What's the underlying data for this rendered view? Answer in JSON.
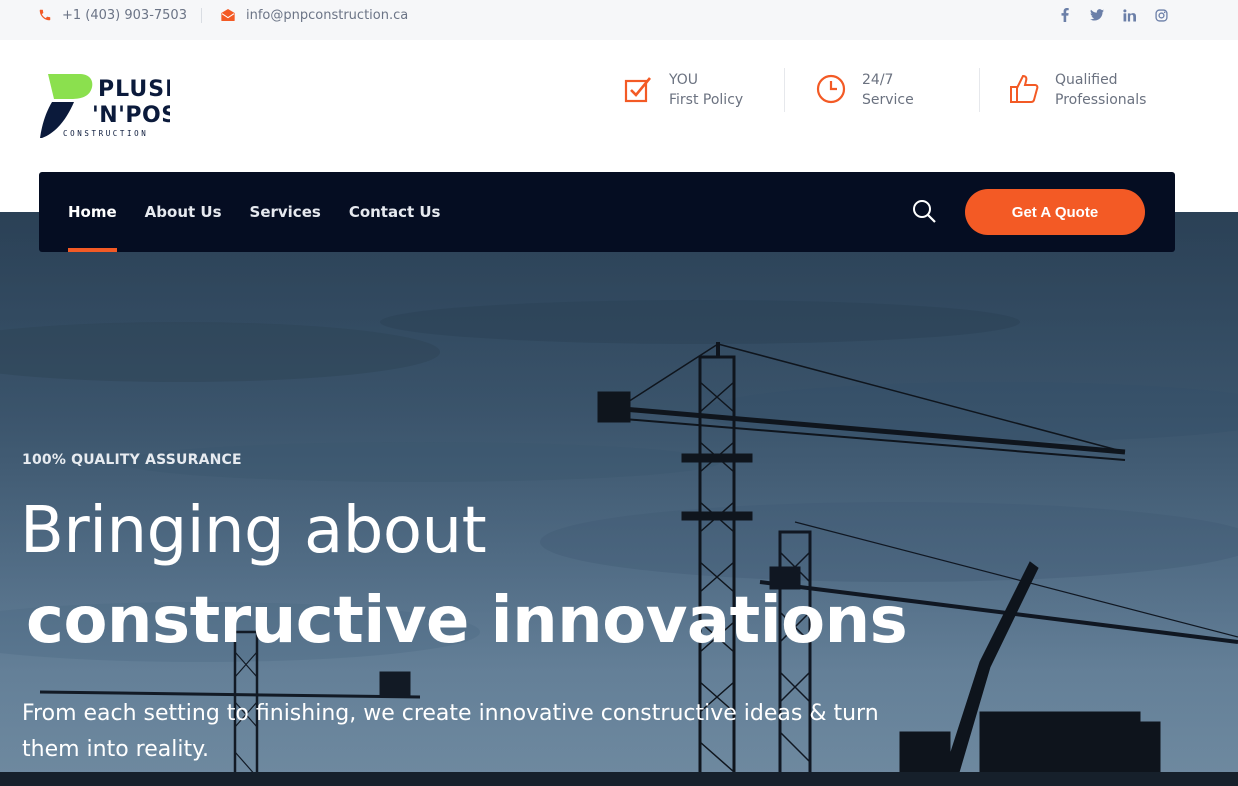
{
  "topbar": {
    "phone": "+1 (403) 903-7503",
    "email": "info@pnpconstruction.ca",
    "social": [
      "facebook-icon",
      "twitter-icon",
      "linkedin-icon",
      "instagram-icon"
    ]
  },
  "logo": {
    "line1": "PLUSH",
    "line2": "'N'POSH",
    "line3": "CONSTRUCTION"
  },
  "features": [
    {
      "icon": "checkbox-icon",
      "line1": "YOU",
      "line2": "First Policy"
    },
    {
      "icon": "clock-icon",
      "line1": "24/7",
      "line2": "Service"
    },
    {
      "icon": "thumbs-up-icon",
      "line1": "Qualified",
      "line2": "Professionals"
    }
  ],
  "nav": {
    "items": [
      "Home",
      "About Us",
      "Services",
      "Contact Us"
    ],
    "active": "Home",
    "quote_label": "Get A Quote"
  },
  "hero": {
    "tag": "100% QUALITY ASSURANCE",
    "title_line1": "Bringing about",
    "title_line2": "constructive innovations",
    "description": "From each setting to finishing, we create innovative constructive ideas & turn them into reality."
  },
  "colors": {
    "accent": "#f35a25",
    "nav_bg": "#050d22",
    "logo_green": "#8be04e",
    "logo_navy": "#0b1a3b"
  }
}
